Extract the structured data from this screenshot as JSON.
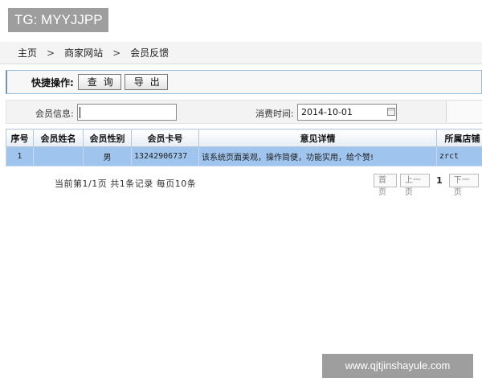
{
  "badge": {
    "text": "TG: MYYJJPP"
  },
  "breadcrumb": {
    "items": [
      "主页",
      "商家网站",
      "会员反馈"
    ],
    "separator": ">"
  },
  "quick_bar": {
    "label": "快捷操作:",
    "query_button": "查询",
    "export_button": "导出"
  },
  "filters": {
    "member_label": "会员信息:",
    "member_value": "",
    "time_label": "消费时间:",
    "time_value": "2014-10-01",
    "calendar_icon": "calendar-icon"
  },
  "table": {
    "headers": [
      "序号",
      "会员姓名",
      "会员性别",
      "会员卡号",
      "意见详情",
      "所属店铺"
    ],
    "rows": [
      {
        "index": "1",
        "name": "",
        "gender": "男",
        "card": "13242906737",
        "detail": "该系统页面美观，操作简便，功能实用，给个赞!",
        "store": "zrct"
      }
    ],
    "row_color": "#9fc4ee"
  },
  "pager": {
    "info": "当前第1/1页 共1条记录 每页10条",
    "first": "首页",
    "prev": "上一页",
    "current": "1",
    "next": "下一页"
  },
  "watermark": {
    "text": "www.qjtjinshayule.com"
  }
}
